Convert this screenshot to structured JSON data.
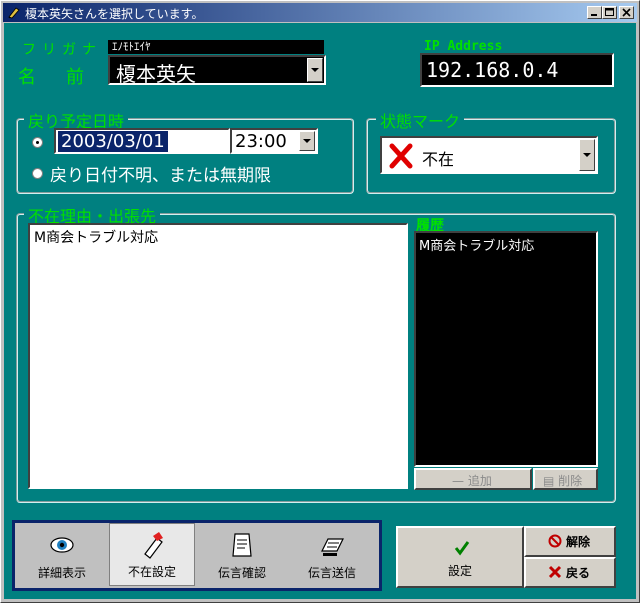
{
  "window": {
    "title": "榎本英矢さんを選択しています。"
  },
  "person": {
    "furigana_label": "フリガナ",
    "furigana_value": "ｴﾉﾓﾄｴｲﾔ",
    "name_label": "名　前",
    "name_value": "榎本英矢"
  },
  "ip": {
    "label": "IP Address",
    "value": "192.168.0.4"
  },
  "return": {
    "group_title": "戻り予定日時",
    "date": "2003/03/01",
    "time": "23:00",
    "unknown_option": "戻り日付不明、または無期限"
  },
  "status": {
    "group_title": "状態マーク",
    "value": "不在"
  },
  "reason": {
    "group_title": "不在理由・出張先",
    "text": "M商会トラブル対応"
  },
  "history": {
    "label": "履歴",
    "items": [
      "M商会トラブル対応"
    ],
    "add_label": "追加",
    "delete_label": "削除"
  },
  "toolbar": {
    "items": [
      {
        "label": "詳細表示",
        "icon": "eye-icon"
      },
      {
        "label": "不在設定",
        "icon": "absence-pen-icon"
      },
      {
        "label": "伝言確認",
        "icon": "message-check-icon"
      },
      {
        "label": "伝言送信",
        "icon": "message-send-icon"
      }
    ]
  },
  "actions": {
    "set_label": "設定",
    "release_label": "解除",
    "back_label": "戻る"
  },
  "colors": {
    "background": "#008080",
    "label_green": "#00e000",
    "title_bar": "#0a246a",
    "toolbar_border": "#0a246a"
  }
}
